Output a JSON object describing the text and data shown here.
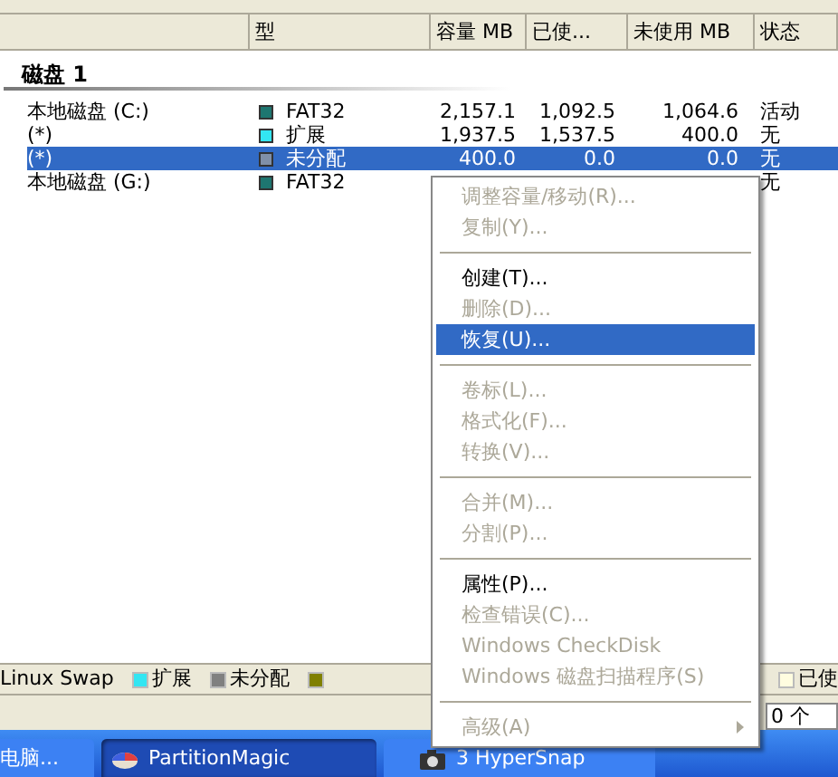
{
  "columns": [
    {},
    {
      "label": "型"
    },
    {
      "label": "容量 MB"
    },
    {
      "label": "已使..."
    },
    {
      "label": "未使用 MB"
    },
    {
      "label": "状态"
    }
  ],
  "disk": {
    "title": "磁盘 1"
  },
  "partitions": [
    {
      "name": "本地磁盘 (C:)",
      "color": "#1e7670",
      "type": "FAT32",
      "capacity": "2,157.1",
      "used": "1,092.5",
      "unused": "1,064.6",
      "status": "活动",
      "selected": false
    },
    {
      "name": "(*)",
      "color": "#33e6f2",
      "type": "扩展",
      "capacity": "1,937.5",
      "used": "1,537.5",
      "unused": "400.0",
      "status": "无",
      "selected": false
    },
    {
      "name": "(*)",
      "color": "#8090a8",
      "type": "未分配",
      "capacity": "400.0",
      "used": "0.0",
      "unused": "0.0",
      "status": "无",
      "selected": true
    },
    {
      "name": "本地磁盘 (G:)",
      "color": "#1e7670",
      "type": "FAT32",
      "status": "无",
      "selected": false
    }
  ],
  "context_menu": [
    {
      "kind": "item",
      "label": "调整容量/移动(R)...",
      "disabled": true,
      "selected": false
    },
    {
      "kind": "item",
      "label": "复制(Y)...",
      "disabled": true,
      "selected": false
    },
    {
      "kind": "separator"
    },
    {
      "kind": "item",
      "label": "创建(T)...",
      "disabled": false,
      "selected": false
    },
    {
      "kind": "item",
      "label": "删除(D)...",
      "disabled": true,
      "selected": false
    },
    {
      "kind": "item",
      "label": "恢复(U)...",
      "disabled": false,
      "selected": true
    },
    {
      "kind": "separator"
    },
    {
      "kind": "item",
      "label": "卷标(L)...",
      "disabled": true,
      "selected": false
    },
    {
      "kind": "item",
      "label": "格式化(F)...",
      "disabled": true,
      "selected": false
    },
    {
      "kind": "item",
      "label": "转换(V)...",
      "disabled": true,
      "selected": false
    },
    {
      "kind": "separator"
    },
    {
      "kind": "item",
      "label": "合并(M)...",
      "disabled": true,
      "selected": false
    },
    {
      "kind": "item",
      "label": "分割(P)...",
      "disabled": true,
      "selected": false
    },
    {
      "kind": "separator"
    },
    {
      "kind": "item",
      "label": "属性(P)...",
      "disabled": false,
      "selected": false
    },
    {
      "kind": "item",
      "label": "检查错误(C)...",
      "disabled": true,
      "selected": false
    },
    {
      "kind": "item",
      "label": "Windows CheckDisk",
      "disabled": true,
      "selected": false
    },
    {
      "kind": "item",
      "label": "Windows 磁盘扫描程序(S)",
      "disabled": true,
      "selected": false
    },
    {
      "kind": "separator"
    },
    {
      "kind": "submenu",
      "label": "高级(A)",
      "disabled": true,
      "selected": false
    }
  ],
  "legend": [
    {
      "label": "Linux Swap"
    },
    {
      "label": "扩展",
      "color": "#33e6f2"
    },
    {
      "label": "未分配",
      "color": "#808080"
    },
    {
      "color": "#808000"
    },
    {
      "label": "已使",
      "color": "#fffde0"
    }
  ],
  "status_bar": {
    "count": "0 个"
  },
  "taskbar": [
    {
      "label": "电脑...",
      "selected": false
    },
    {
      "label": "PartitionMagic",
      "selected": true
    },
    {
      "label": "3 HyperSnap",
      "selected": false
    }
  ]
}
